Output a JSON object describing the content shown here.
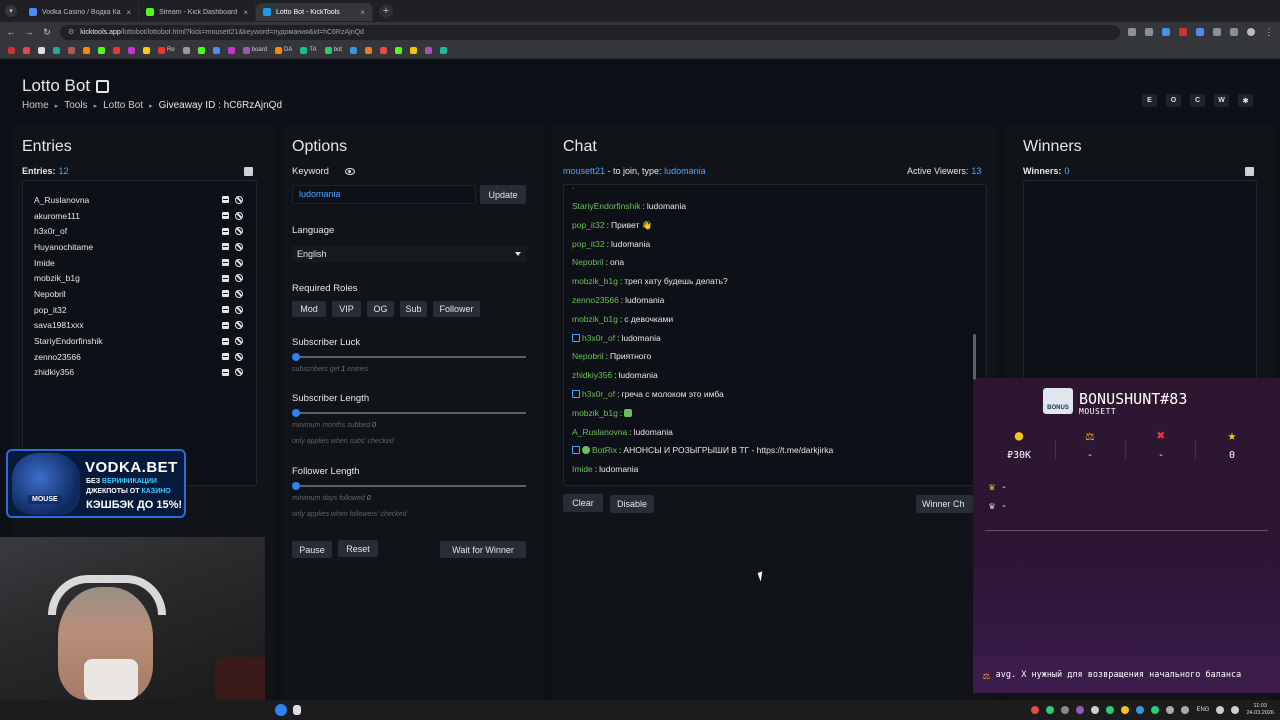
{
  "browser": {
    "tabs": [
      {
        "title": "Vodka Casino / Водка Казино",
        "active": false,
        "color": "#4b8bf5"
      },
      {
        "title": "Stream - Kick Dashboard",
        "active": false,
        "color": "#53fc18"
      },
      {
        "title": "Lotto Bot - KickTools",
        "active": true,
        "color": "#1d9bf0"
      }
    ],
    "url_host": "kicktools.app",
    "url_path": "/lottobot/lottobot.html?kick=mousett21&keyword=лудомания&id=hC6RzAjnQd",
    "bookmarks": [
      {
        "label": "",
        "color": "#c33"
      },
      {
        "label": "",
        "color": "#e44"
      },
      {
        "label": "",
        "color": "#ddd"
      },
      {
        "label": "",
        "color": "#2a9"
      },
      {
        "label": "",
        "color": "#b55"
      },
      {
        "label": "",
        "color": "#f80"
      },
      {
        "label": "",
        "color": "#53fc18"
      },
      {
        "label": "",
        "color": "#e33"
      },
      {
        "label": "",
        "color": "#c3c"
      },
      {
        "label": "",
        "color": "#fc0"
      },
      {
        "label": "Re",
        "color": "#e33"
      },
      {
        "label": "",
        "color": "#999"
      },
      {
        "label": "",
        "color": "#53fc18"
      },
      {
        "label": "",
        "color": "#4b8bf5"
      },
      {
        "label": "",
        "color": "#c3c"
      },
      {
        "label": "board",
        "color": "#9b59b6"
      },
      {
        "label": "DA",
        "color": "#f80"
      },
      {
        "label": "TA",
        "color": "#1abc9c"
      },
      {
        "label": "bot",
        "color": "#2ecc71"
      },
      {
        "label": "",
        "color": "#3498db"
      },
      {
        "label": "",
        "color": "#e67e22"
      },
      {
        "label": "",
        "color": "#e74c3c"
      },
      {
        "label": "",
        "color": "#53fc18"
      },
      {
        "label": "",
        "color": "#f1c40f"
      },
      {
        "label": "",
        "color": "#9b59b6"
      },
      {
        "label": "",
        "color": "#1abc9c"
      }
    ]
  },
  "header": {
    "title": "Lotto Bot",
    "breadcrumb": [
      "Home",
      "Tools",
      "Lotto Bot"
    ],
    "breadcrumb_current": "Giveaway ID :  hC6RzAjnQd",
    "tool_buttons": [
      "E",
      "O",
      "C",
      "W",
      "✱"
    ]
  },
  "entries": {
    "title": "Entries",
    "count_label": "Entries:",
    "count": "12",
    "items": [
      "A_Ruslanovna",
      "akurome111",
      "h3x0r_of",
      "Huyanochitame",
      "Imide",
      "mobzik_b1g",
      "Nepobril",
      "pop_it32",
      "sava1981xxx",
      "StariyEndorfinshik",
      "zenno23566",
      "zhidkiy356"
    ]
  },
  "options": {
    "title": "Options",
    "keyword_label": "Keyword",
    "keyword_value": "ludomania",
    "update_label": "Update",
    "language_label": "Language",
    "language_value": "English",
    "roles_label": "Required Roles",
    "roles": [
      "Mod",
      "VIP",
      "OG",
      "Sub",
      "Follower"
    ],
    "sub_luck_label": "Subscriber Luck",
    "sub_luck_hint_pre": "subscribers get",
    "sub_luck_value": "1",
    "sub_luck_hint_post": "entries",
    "sub_length_label": "Subscriber Length",
    "sub_length_hint_pre": "minimum months subbed",
    "sub_length_value": "0",
    "sub_length_hint2": "only applies when subs' checked",
    "follow_length_label": "Follower Length",
    "follow_length_hint_pre": "minimum days followed",
    "follow_length_value": "0",
    "follow_length_hint2": "only applies when followers' checked",
    "pause_label": "Pause",
    "reset_label": "Reset",
    "wait_label": "Wait for Winner"
  },
  "chat": {
    "title": "Chat",
    "user": "mousett21",
    "join_text": " - to join, type: ",
    "keyword": "ludomania",
    "viewers_label": "Active Viewers:",
    "viewers": "13",
    "messages": [
      {
        "user": "StariyEndorfinshik",
        "text": "ludomania",
        "badge": ""
      },
      {
        "user": "pop_it32",
        "text": "Привет 👋",
        "badge": ""
      },
      {
        "user": "pop_it32",
        "text": "ludomania",
        "badge": ""
      },
      {
        "user": "Nepobril",
        "text": "опа",
        "badge": ""
      },
      {
        "user": "mobzik_b1g",
        "text": "треп хату будешь делать?",
        "badge": ""
      },
      {
        "user": "zenno23566",
        "text": "ludomania",
        "badge": ""
      },
      {
        "user": "mobzik_b1g",
        "text": "с девочками",
        "badge": ""
      },
      {
        "user": "h3x0r_of",
        "text": "ludomania",
        "badge": "sub"
      },
      {
        "user": "Nepobril",
        "text": "Приятного",
        "badge": ""
      },
      {
        "user": "zhidkiy356",
        "text": "ludomania",
        "badge": ""
      },
      {
        "user": "h3x0r_of",
        "text": "греча с молоком это имба",
        "badge": "sub"
      },
      {
        "user": "mobzik_b1g",
        "text": "",
        "badge": "",
        "emote_color": "#6bbf59"
      },
      {
        "user": "A_Ruslanovna",
        "text": "ludomania",
        "badge": ""
      },
      {
        "user": "BotRix",
        "text": "АНОНСЫ И РОЗЫГРЫШИ В ТГ - https://t.me/darkjirka",
        "badge": "bot"
      },
      {
        "user": "Imide",
        "text": "ludomania",
        "badge": ""
      }
    ],
    "clear_label": "Clear",
    "disable_label": "Disable",
    "winner_chat_label": "Winner Ch"
  },
  "winners": {
    "title": "Winners",
    "count_label": "Winners:",
    "count": "0"
  },
  "vodka_ad": {
    "logo": "VODKA.BET",
    "streamer": "MOUSE",
    "line1_pre": "БЕЗ ",
    "line1_hl": "ВЕРИФИКАЦИИ",
    "line2_pre": "ДЖЕКПОТЫ ОТ ",
    "line2_hl": "КАЗИНО",
    "line3": "КЭШБЭК ДО 15%!"
  },
  "bonushunt": {
    "box_label": "BONUS",
    "title": "BONUSHUNT#83",
    "subtitle": "MOUSETT",
    "stats": [
      {
        "icon": "coin-icon",
        "value": "₽30K",
        "color": "#f5c518"
      },
      {
        "icon": "scale-icon",
        "value": "-",
        "color": "#f5a623"
      },
      {
        "icon": "cross-icon",
        "value": "-",
        "color": "#e63946"
      },
      {
        "icon": "star-icon",
        "value": "0",
        "color": "#f5c518"
      }
    ],
    "crown1": "-",
    "crown2": "-",
    "footer": "avg. X нужный для возвращения начального баланса"
  },
  "taskbar": {
    "lang": "ENG",
    "time": "11:03",
    "date": "24.03.2026"
  }
}
